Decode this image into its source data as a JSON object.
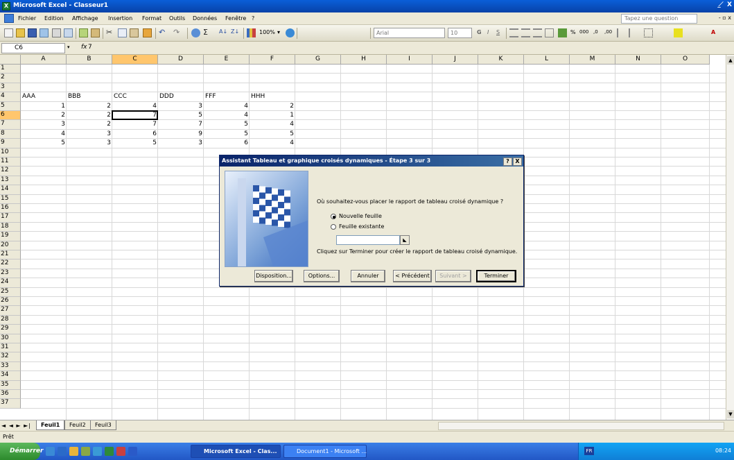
{
  "window": {
    "title": "Microsoft Excel - Classeur1",
    "controls": "_ ̸ X"
  },
  "menu": {
    "items": [
      "Fichier",
      "Edition",
      "Affichage",
      "Insertion",
      "Format",
      "Outils",
      "Données",
      "Fenêtre",
      "?"
    ],
    "ask_placeholder": "Tapez une question"
  },
  "toolbar": {
    "zoom": "100%",
    "font_name": "Arial",
    "font_size": "10",
    "percent": "%",
    "thousands": "000"
  },
  "formula_bar": {
    "name_box": "C6",
    "fx": "fx",
    "value": "7"
  },
  "columns": [
    "A",
    "B",
    "C",
    "D",
    "E",
    "F",
    "G",
    "H",
    "I",
    "J",
    "K",
    "L",
    "M",
    "N",
    "O"
  ],
  "rows": [
    "1",
    "2",
    "3",
    "4",
    "5",
    "6",
    "7",
    "8",
    "9",
    "10",
    "11",
    "12",
    "13",
    "14",
    "15",
    "16",
    "17",
    "18",
    "19",
    "20",
    "21",
    "22",
    "23",
    "24",
    "25",
    "26",
    "27",
    "28",
    "29",
    "30",
    "31",
    "32",
    "33",
    "34",
    "35",
    "36",
    "37"
  ],
  "selected": {
    "col": "C",
    "row": "6"
  },
  "table": {
    "headers": [
      "AAA",
      "BBB",
      "CCC",
      "DDD",
      "FFF",
      "HHH"
    ],
    "data": [
      [
        "1",
        "2",
        "4",
        "3",
        "4",
        "2"
      ],
      [
        "2",
        "2",
        "7",
        "5",
        "4",
        "1"
      ],
      [
        "3",
        "2",
        "7",
        "7",
        "5",
        "4"
      ],
      [
        "4",
        "3",
        "6",
        "9",
        "5",
        "5"
      ],
      [
        "5",
        "3",
        "5",
        "3",
        "6",
        "4"
      ]
    ]
  },
  "sheets": {
    "nav": "◄ ◄ ► ►|",
    "tabs": [
      "Feuil1",
      "Feuil2",
      "Feuil3"
    ],
    "active": "Feuil1"
  },
  "status": "Prêt",
  "taskbar": {
    "start": "Démarrer",
    "buttons": [
      "Microsoft Excel - Clas...",
      "Document1 - Microsoft ..."
    ],
    "lang": "FR",
    "clock": "08:24"
  },
  "dialog": {
    "title": "Assistant Tableau et graphique croisés dynamiques - Étape 3 sur 3",
    "help_btn": "?",
    "close_btn": "X",
    "question": "Où souhaitez-vous placer le rapport de tableau croisé dynamique ?",
    "option_new": "Nouvelle feuille",
    "option_existing": "Feuille existante",
    "hint": "Cliquez sur Terminer pour créer le rapport de tableau croisé dynamique.",
    "buttons": {
      "layout": "Disposition...",
      "options": "Options...",
      "cancel": "Annuler",
      "prev": "< Précédent",
      "next": "Suivant >",
      "finish": "Terminer"
    }
  },
  "colors": {
    "title_blue": "#0842a8",
    "selection": "#ffc66d",
    "chrome": "#ece9d8"
  }
}
